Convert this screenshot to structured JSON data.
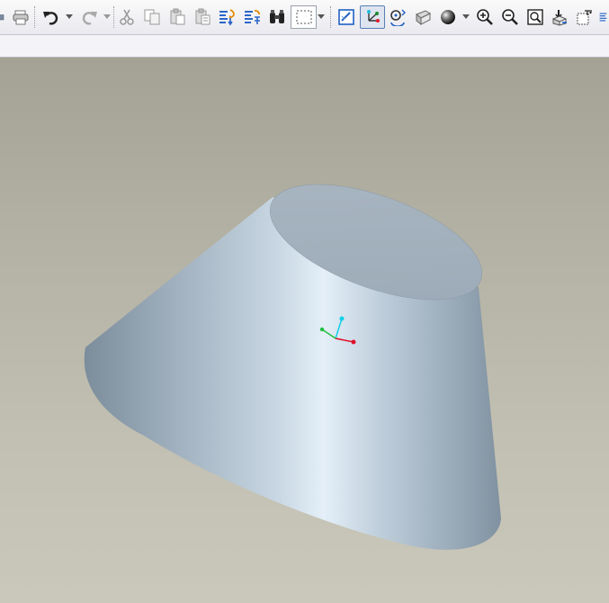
{
  "toolbar": {
    "buttons": [
      {
        "name": "save-icon"
      },
      {
        "name": "print-icon"
      },
      {
        "name": "undo-icon"
      },
      {
        "name": "redo-icon"
      },
      {
        "name": "cut-icon"
      },
      {
        "name": "copy-icon"
      },
      {
        "name": "paste-icon"
      },
      {
        "name": "paste-special-icon"
      },
      {
        "name": "regenerate-icon"
      },
      {
        "name": "regeneration-manager-icon"
      },
      {
        "name": "find-icon"
      },
      {
        "name": "selection-filter-icon"
      },
      {
        "name": "repaint-icon"
      },
      {
        "name": "spin-center-icon"
      },
      {
        "name": "orient-mode-icon"
      },
      {
        "name": "saved-views-icon"
      },
      {
        "name": "display-style-icon"
      },
      {
        "name": "zoom-in-icon"
      },
      {
        "name": "zoom-out-icon"
      },
      {
        "name": "refit-icon"
      },
      {
        "name": "reorient-icon"
      },
      {
        "name": "annotations-icon"
      }
    ],
    "active_tool": "spin-center-icon",
    "accent_color": "#1f5fc4"
  },
  "viewport": {
    "background_top": "#a4a294",
    "background_bottom": "#cac8ba",
    "model": {
      "shape": "frustum-of-cone",
      "color": "#aab8c4",
      "highlight_color": "#e6f0f8"
    },
    "spin_center": {
      "x_axis_color": "#e0102a",
      "y_axis_color": "#10d0e8",
      "z_axis_color": "#20c040"
    }
  }
}
